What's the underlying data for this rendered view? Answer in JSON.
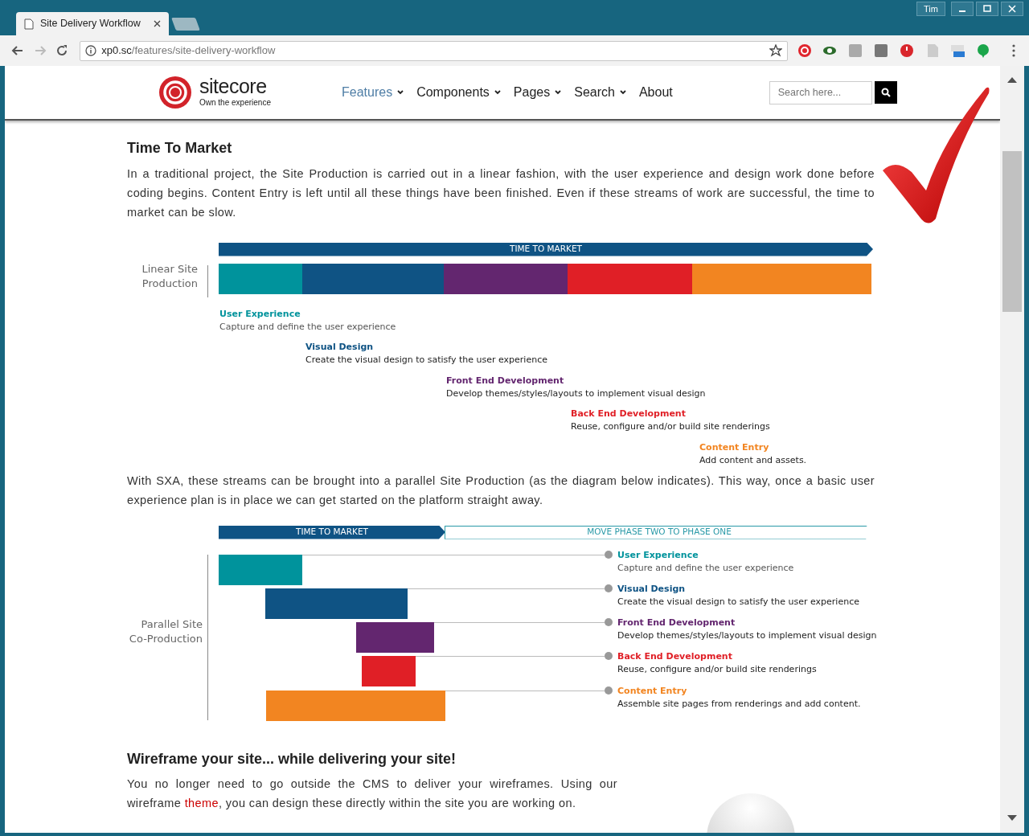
{
  "browser": {
    "tabs": [
      {
        "title": "Site Delivery Workflow",
        "selected": true
      }
    ],
    "user": "Tim",
    "address_host": "xp0.sc",
    "address_path": "/features/site-delivery-workflow"
  },
  "site": {
    "logo": {
      "name": "sitecore",
      "tagline": "Own the experience"
    },
    "menu": [
      {
        "label": "Features",
        "dropdown": true,
        "selected": true
      },
      {
        "label": "Components",
        "dropdown": true,
        "selected": false
      },
      {
        "label": "Pages",
        "dropdown": true,
        "selected": false
      },
      {
        "label": "Search",
        "dropdown": true,
        "selected": false
      },
      {
        "label": "About",
        "dropdown": false,
        "selected": false
      }
    ],
    "search": {
      "placeholder": "Search here..."
    }
  },
  "article": {
    "heading": "Time To Market",
    "intro": "In a traditional project, the Site Production is carried out in a linear fashion, with the user experience and design work done before coding begins. Content Entry is left until all these things have been finished. Even if these streams of work are successful, the time to market can be slow.",
    "linear_diagram": {
      "banner": "TIME TO MARKET",
      "label": "Linear Site Production",
      "stages": [
        {
          "title": "User Experience",
          "description": "Capture and define the user experience",
          "color": "#00939c"
        },
        {
          "title": "Visual Design",
          "description": "Create the visual design to satisfy the user experience",
          "color": "#0f5384"
        },
        {
          "title": "Front End Development",
          "description": "Develop themes/styles/layouts to implement visual design",
          "color": "#63266f"
        },
        {
          "title": "Back End Development",
          "description": "Reuse, configure and/or build site renderings",
          "color": "#e01f26"
        },
        {
          "title": "Content Entry",
          "description": "Add content and assets.",
          "color": "#f28521"
        }
      ]
    },
    "middle": "With SXA, these streams can be brought into a parallel Site Production (as the diagram below indicates). This way, once a basic user experience plan is in place we can get started on the platform straight away.",
    "parallel_diagram": {
      "banners": [
        "TIME TO MARKET",
        "MOVE PHASE TWO TO PHASE ONE"
      ],
      "label": "Parallel Site Co-Production",
      "stages": [
        {
          "title": "User Experience",
          "description": "Capture and define the user experience",
          "color": "#00939c"
        },
        {
          "title": "Visual Design",
          "description": "Create the visual design to satisfy the user experience",
          "color": "#0f5384"
        },
        {
          "title": "Front End Development",
          "description": "Develop themes/styles/layouts to implement visual design",
          "color": "#63266f"
        },
        {
          "title": "Back End Development",
          "description": "Reuse, configure and/or build site renderings",
          "color": "#e01f26"
        },
        {
          "title": "Content Entry",
          "description": "Assemble site pages from renderings and add content.",
          "color": "#f28521"
        }
      ]
    },
    "heading2": "Wireframe your site... while delivering your site!",
    "wireframe_text": {
      "before": "You no longer need to go outside the CMS to deliver your wireframes. Using our wireframe",
      "link": "theme",
      "after": ", you can design these directly within the site you are working on."
    }
  }
}
